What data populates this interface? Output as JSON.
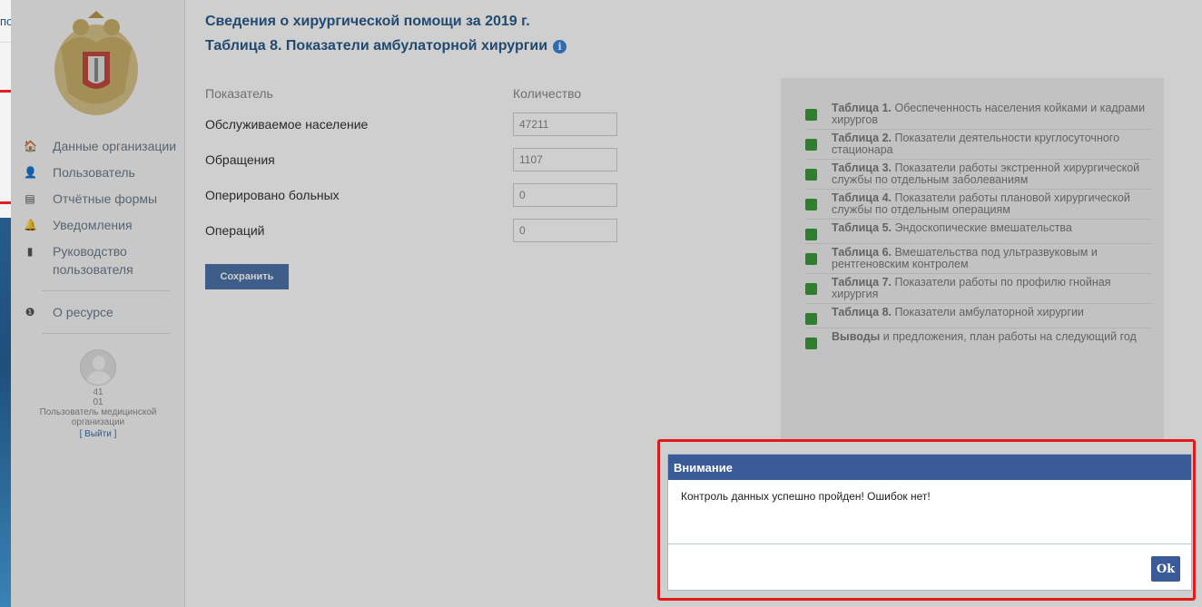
{
  "background_fragment": {
    "text": "по"
  },
  "sidebar": {
    "nav": [
      {
        "icon": "home-icon",
        "glyph": "🏠",
        "label": "Данные организации"
      },
      {
        "icon": "user-icon",
        "glyph": "👤",
        "label": "Пользователь"
      },
      {
        "icon": "forms-icon",
        "glyph": "▤",
        "label": "Отчётные формы"
      },
      {
        "icon": "bell-icon",
        "glyph": "🔔",
        "label": "Уведомления"
      },
      {
        "icon": "document-icon",
        "glyph": "▮",
        "label": "Руководство пользователя"
      }
    ],
    "about": {
      "icon": "info-circle-icon",
      "glyph": "❶",
      "label": "О ресурсе"
    },
    "user": {
      "line1": "41",
      "line2": "01",
      "role": "Пользователь медицинской организации",
      "logout": "[ Выйти ]"
    }
  },
  "main": {
    "title": "Сведения о хирургической помощи за 2019 г.",
    "subtitle": "Таблица 8. Показатели амбулаторной хирургии",
    "form": {
      "col_indicator": "Показатель",
      "col_quantity": "Количество",
      "rows": [
        {
          "label": "Обслуживаемое население",
          "value": "47211"
        },
        {
          "label": "Обращения",
          "value": "1107"
        },
        {
          "label": "Оперировано больных",
          "value": "0"
        },
        {
          "label": "Операций",
          "value": "0"
        }
      ],
      "save_label": "Сохранить"
    },
    "tables": [
      {
        "bold": "Таблица 1.",
        "text": " Обеспеченность населения койками и кадрами хирургов"
      },
      {
        "bold": "Таблица 2.",
        "text": " Показатели деятельности круглосуточного стационара"
      },
      {
        "bold": "Таблица 3.",
        "text": " Показатели работы экстренной хирургической службы по отдельным заболеваниям"
      },
      {
        "bold": "Таблица 4.",
        "text": " Показатели работы плановой хирургической службы по отдельным операциям"
      },
      {
        "bold": "Таблица 5.",
        "text": " Эндоскопические вмешательства"
      },
      {
        "bold": "Таблица 6.",
        "text": " Вмешательства под ультразвуковым и рентгеновским контролем"
      },
      {
        "bold": "Таблица 7.",
        "text": " Показатели работы по профилю гнойная хирургия"
      },
      {
        "bold": "Таблица 8.",
        "text": " Показатели амбулаторной хирургии"
      },
      {
        "bold": "Выводы",
        "text": " и предложения, план работы на следующий год"
      }
    ]
  },
  "dialog": {
    "title": "Внимание",
    "message": "Контроль данных успешно пройден! Ошибок нет!",
    "ok_label": "Ok"
  },
  "colors": {
    "header_blue": "#3a5b97",
    "highlight_red": "#e11b1b",
    "table_marker_green": "#3a9a3a"
  }
}
